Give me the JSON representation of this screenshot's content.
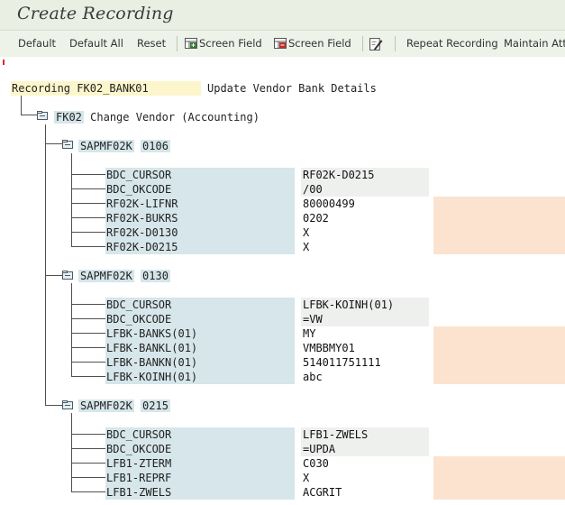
{
  "window": {
    "title": "Create Recording"
  },
  "toolbar": {
    "default": "Default",
    "default_all": "Default All",
    "reset": "Reset",
    "insert_screen_field": "Screen Field",
    "delete_screen_field": "Screen Field",
    "repeat_recording": "Repeat Recording",
    "maintain_attributes": "Maintain Attri"
  },
  "recording": {
    "label": "Recording",
    "name": "FK02_BANK01",
    "description": "Update Vendor Bank Details",
    "transaction": {
      "code": "FK02",
      "text": "Change Vendor (Accounting)"
    },
    "screens": [
      {
        "program": "SAPMF02K",
        "number": "0106",
        "fields": [
          {
            "name": "BDC_CURSOR",
            "value": "RF02K-D0215",
            "editable": false
          },
          {
            "name": "BDC_OKCODE",
            "value": "/00",
            "editable": false
          },
          {
            "name": "RF02K-LIFNR",
            "value": "80000499",
            "editable": true
          },
          {
            "name": "RF02K-BUKRS",
            "value": "0202",
            "editable": true
          },
          {
            "name": "RF02K-D0130",
            "value": "X",
            "editable": true
          },
          {
            "name": "RF02K-D0215",
            "value": "X",
            "editable": true
          }
        ]
      },
      {
        "program": "SAPMF02K",
        "number": "0130",
        "fields": [
          {
            "name": "BDC_CURSOR",
            "value": "LFBK-KOINH(01)",
            "editable": false
          },
          {
            "name": "BDC_OKCODE",
            "value": "=VW",
            "editable": false
          },
          {
            "name": "LFBK-BANKS(01)",
            "value": "MY",
            "editable": true
          },
          {
            "name": "LFBK-BANKL(01)",
            "value": "VMBBMY01",
            "editable": true
          },
          {
            "name": "LFBK-BANKN(01)",
            "value": "514011751111",
            "editable": true
          },
          {
            "name": "LFBK-KOINH(01)",
            "value": "abc",
            "editable": true
          }
        ]
      },
      {
        "program": "SAPMF02K",
        "number": "0215",
        "fields": [
          {
            "name": "BDC_CURSOR",
            "value": "LFB1-ZWELS",
            "editable": false
          },
          {
            "name": "BDC_OKCODE",
            "value": "=UPDA",
            "editable": false
          },
          {
            "name": "LFB1-ZTERM",
            "value": "C030",
            "editable": true
          },
          {
            "name": "LFB1-REPRF",
            "value": "X",
            "editable": true
          },
          {
            "name": "LFB1-ZWELS",
            "value": "ACGRIT",
            "editable": true
          }
        ]
      }
    ]
  },
  "colors": {
    "name_column": "#d6e6ea",
    "header_highlight": "#fdf6cc",
    "editable_extension": "#fbe3cf",
    "toolbar_bg": "#eef3ea"
  },
  "icons": [
    "insert-screen-field-icon",
    "delete-screen-field-icon",
    "edit-icon",
    "folder-icon"
  ]
}
